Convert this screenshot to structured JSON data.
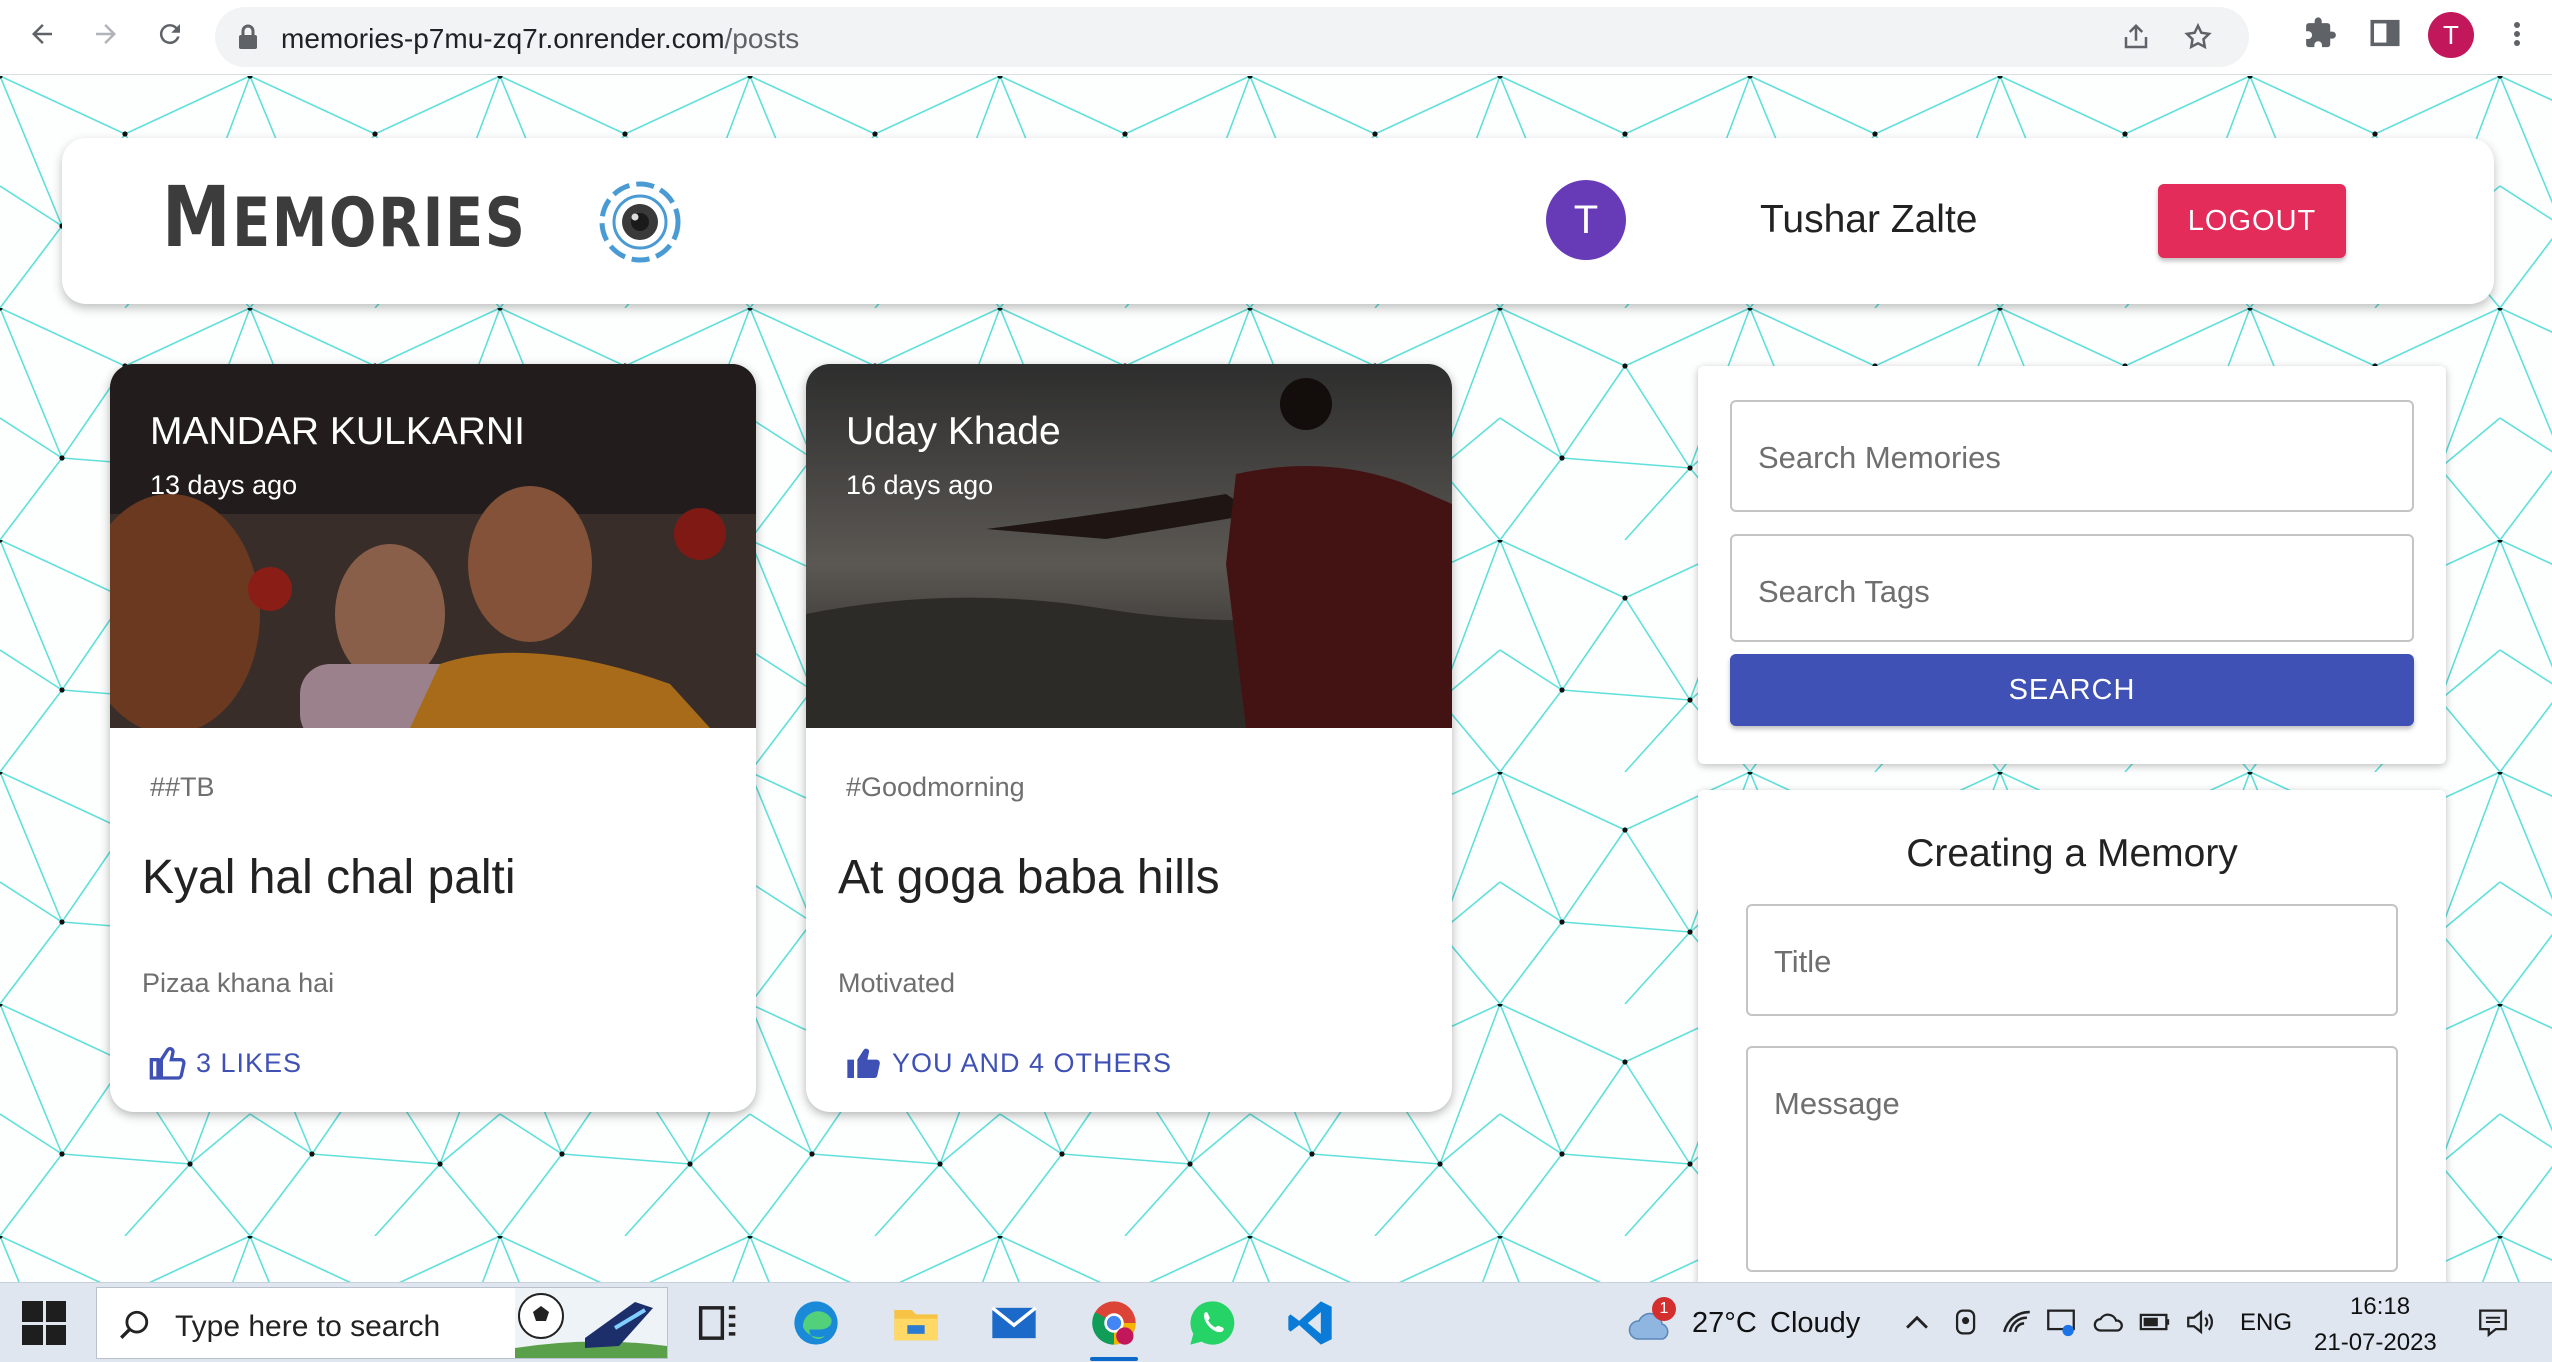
{
  "browser": {
    "url_host": "memories-p7mu-zq7r.onrender.com",
    "url_path": "/posts",
    "profile_initial": "T"
  },
  "app": {
    "brand": {
      "first": "M",
      "rest": "EMORIES"
    },
    "user": {
      "initial": "T",
      "name": "Tushar Zalte"
    },
    "logout_label": "LOGOUT",
    "colors": {
      "primary": "#3f51b5",
      "logout": "#e32c5a",
      "avatar": "#673ab7",
      "pattern": "#5fe0da"
    }
  },
  "posts": [
    {
      "author": "MANDAR KULKARNI",
      "time": "13 days ago",
      "tags": "##TB",
      "title": "Kyal hal chal palti",
      "message": "Pizaa khana hai",
      "likes": "3 LIKES",
      "liked": false
    },
    {
      "author": "Uday Khade",
      "time": "16 days ago",
      "tags": "#Goodmorning",
      "title": "At goga baba hills",
      "message": "Motivated",
      "likes": "YOU AND 4 OTHERS",
      "liked": true
    }
  ],
  "search": {
    "memories_placeholder": "Search Memories",
    "tags_placeholder": "Search Tags",
    "button_label": "SEARCH"
  },
  "form": {
    "heading": "Creating a Memory",
    "title_placeholder": "Title",
    "message_placeholder": "Message"
  },
  "taskbar": {
    "search_placeholder": "Type here to search",
    "weather": {
      "temp": "27°C",
      "condition": "Cloudy",
      "badge": "1"
    },
    "language": "ENG",
    "time": "16:18",
    "date": "21-07-2023",
    "apps": [
      "task-view",
      "edge",
      "file-explorer",
      "mail",
      "chrome",
      "whatsapp",
      "vscode"
    ]
  }
}
